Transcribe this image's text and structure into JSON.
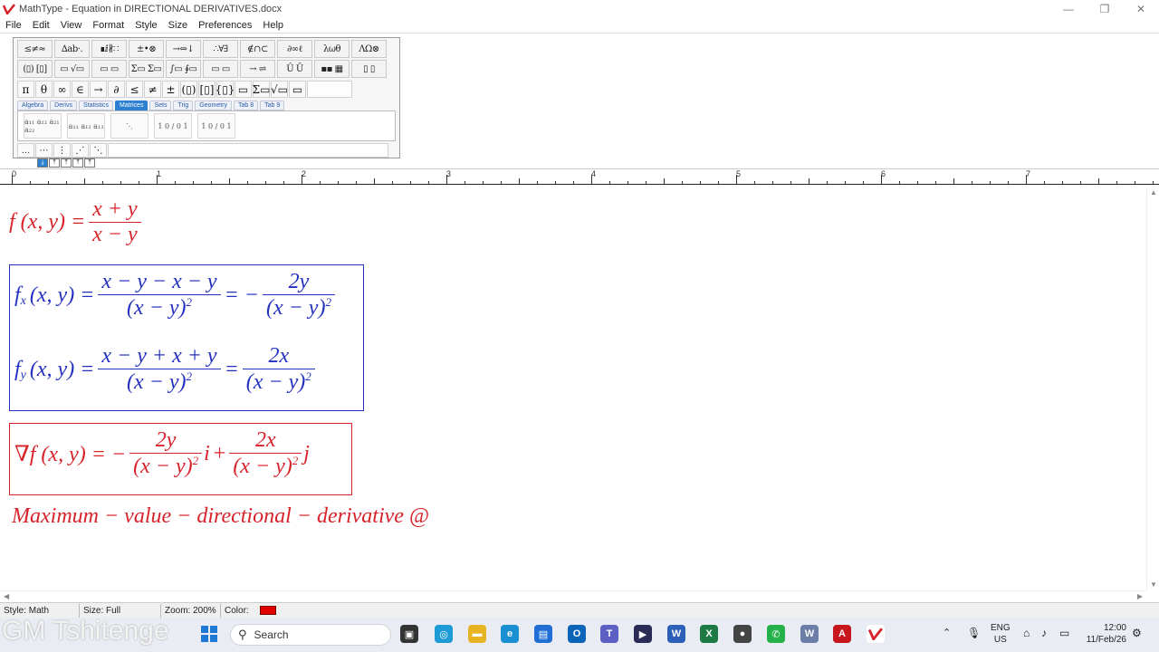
{
  "window": {
    "title": "MathType - Equation in DIRECTIONAL DERIVATIVES.docx",
    "minimize": "—",
    "maximize": "❐",
    "close": "✕"
  },
  "menu": [
    "File",
    "Edit",
    "View",
    "Format",
    "Style",
    "Size",
    "Preferences",
    "Help"
  ],
  "palette": {
    "row1": [
      "≤≠≈",
      "∆ab·.",
      "∎ⅈ∦∷",
      "±•⊗",
      "→⇔↓",
      "∴∀∃",
      "∉∩⊂",
      "∂∞ℓ",
      "λωθ",
      "ΛΩ⊗"
    ],
    "row2": [
      "(▯) [▯]",
      "▭ √▭",
      "▭ ▭",
      "Σ▭ Σ▭",
      "∫▭ ∮▭",
      "▭ ▭",
      "→ ⇌",
      "Û Ū",
      "▪▪ ▦",
      "▯ ▯"
    ],
    "symbols": [
      "π",
      "θ",
      "∞",
      "∈",
      "→",
      "∂",
      "≤",
      "≠",
      "±",
      "(▯)",
      "[▯]",
      "{▯}",
      "▭",
      "Σ▭",
      "√▭",
      "▭"
    ],
    "tabs": [
      "Algebra",
      "Derivs",
      "Statistics",
      "Matrices",
      "Sets",
      "Trig",
      "Geometry",
      "Tab 8",
      "Tab 9"
    ],
    "active_tab": "Matrices",
    "matrices": [
      "a₁₁ a₁₂ a₂₁ a₂₂",
      "a₁₁ a₁₂ a₁₃",
      "⋱",
      "1 0 / 0 1",
      "1 0 / 0 1"
    ],
    "dots": [
      "…",
      "⋯",
      "⋮",
      "⋰",
      "⋱"
    ]
  },
  "tabstops": [
    "⤓",
    "⤒",
    "⤒",
    "⤒",
    "⤒"
  ],
  "ruler": {
    "labels": [
      "0",
      "1",
      "2",
      "3",
      "4",
      "5",
      "6",
      "7"
    ]
  },
  "equations": {
    "eq1": {
      "lhs": "f (x, y) =",
      "num": "x + y",
      "den": "x − y"
    },
    "eq2": {
      "lhs": "f",
      "sub": "x",
      "args": "(x, y) =",
      "num1": "x − y − x − y",
      "den1": "(x − y)",
      "sup": "2",
      "mid": "= −",
      "num2": "2y",
      "den2": "(x − y)"
    },
    "eq3": {
      "lhs": "f",
      "sub": "y",
      "args": "(x, y) =",
      "num1": "x − y + x + y",
      "den1": "(x − y)",
      "sup": "2",
      "mid": "=",
      "num2": "2x",
      "den2": "(x − y)"
    },
    "eq4": {
      "lhs": "∇f (x, y) = −",
      "num1": "2y",
      "den1": "(x − y)",
      "sup": "2",
      "i": "i",
      "plus": "+",
      "num2": "2x",
      "den2": "(x − y)",
      "j": "j"
    },
    "eq5": {
      "text": "Maximum − value − directional − derivative @"
    }
  },
  "status": {
    "style": "Style: Math",
    "size": "Size: Full",
    "zoom": "Zoom: 200%",
    "color_label": "Color:",
    "color_value": "#e00000"
  },
  "taskbar": {
    "watermark": "GM Tshitenge",
    "search": "Search",
    "lang1": "ENG",
    "lang2": "US",
    "time": "12:00",
    "date": "11/Feb/26"
  },
  "colors": {
    "red": "#d8222a",
    "blue": "#2430c0",
    "accent": "#2d7fd0"
  }
}
